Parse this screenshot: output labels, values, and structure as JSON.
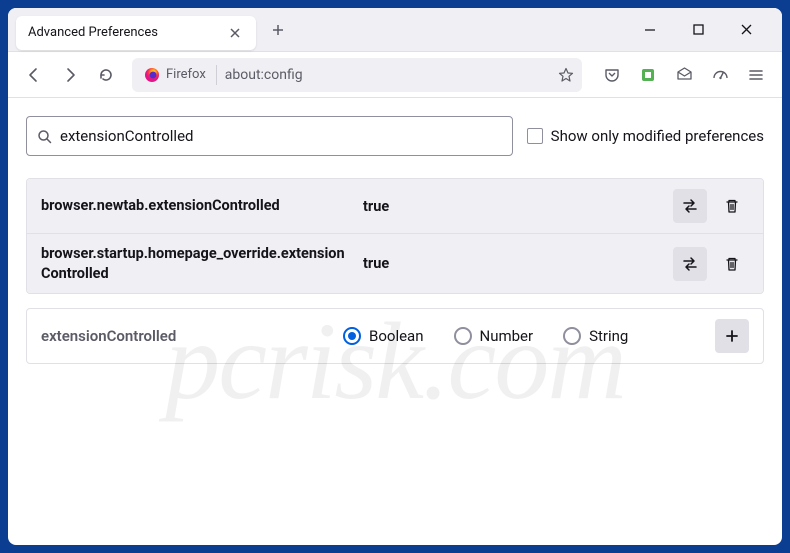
{
  "window": {
    "tab_title": "Advanced Preferences"
  },
  "toolbar": {
    "identity_label": "Firefox",
    "url": "about:config"
  },
  "search": {
    "value": "extensionControlled",
    "checkbox_label": "Show only modified preferences"
  },
  "results": [
    {
      "name": "browser.newtab.extensionControlled",
      "value": "true",
      "modified": true
    },
    {
      "name": "browser.startup.homepage_override.extensionControlled",
      "value": "true",
      "modified": true
    }
  ],
  "add_pref": {
    "name": "extensionControlled",
    "types": [
      "Boolean",
      "Number",
      "String"
    ],
    "selected": "Boolean"
  },
  "watermark": "pcrisk.com"
}
